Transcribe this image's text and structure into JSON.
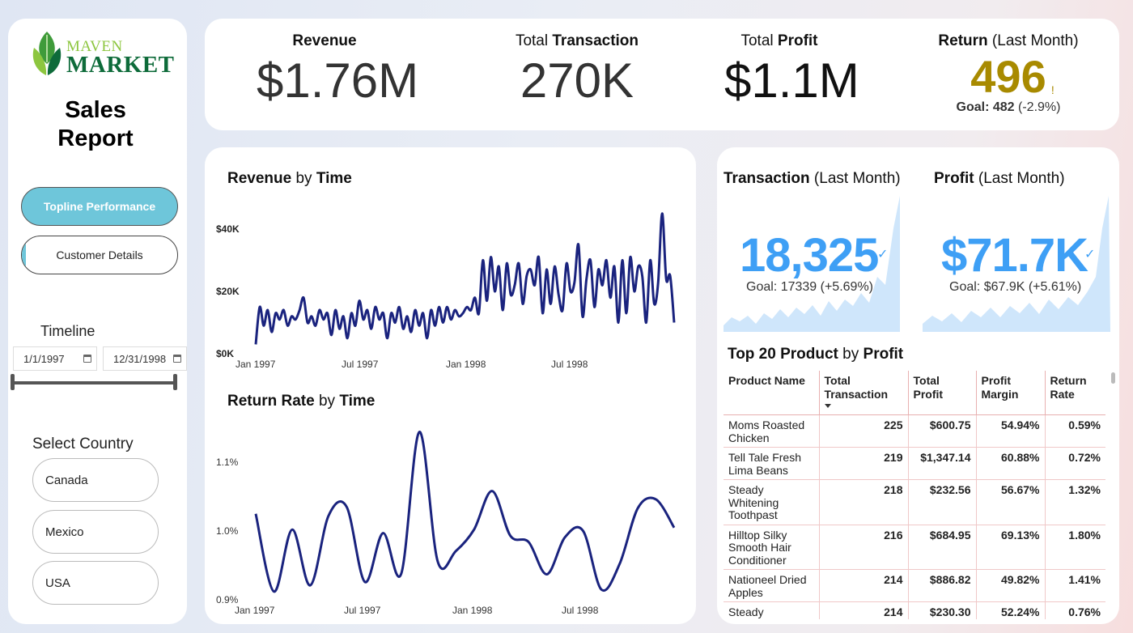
{
  "sidebar": {
    "logo_top": "MAVEN",
    "logo_bottom": "MARKET",
    "title_line1": "Sales",
    "title_line2": "Report",
    "nav": {
      "topline": "Topline Performance",
      "customer": "Customer Details"
    },
    "timeline_label": "Timeline",
    "date_start": "1/1/1997",
    "date_end": "12/31/1998",
    "country_label": "Select Country",
    "countries": [
      "Canada",
      "Mexico",
      "USA"
    ]
  },
  "kpi": {
    "revenue": {
      "title_bold": "Revenue",
      "value": "$1.76M"
    },
    "transaction": {
      "title_plain": "Total ",
      "title_bold": "Transaction",
      "value": "270K"
    },
    "profit": {
      "title_plain": "Total ",
      "title_bold": "Profit",
      "value": "$1.1M"
    },
    "return": {
      "title_bold": "Return",
      "title_plain": " (Last Month)",
      "value": "496",
      "warn": "!",
      "goal_label": "Goal: ",
      "goal_value": "482",
      "goal_delta": " (-2.9%)"
    }
  },
  "charts": {
    "revenue_title_bold1": "Revenue",
    "revenue_title_plain": " by ",
    "revenue_title_bold2": "Time",
    "return_title_bold1": "Return Rate",
    "return_title_plain": " by ",
    "return_title_bold2": "Time"
  },
  "chart_data": [
    {
      "type": "line",
      "title": "Revenue by Time",
      "x_ticks": [
        "Jan 1997",
        "Jul 1997",
        "Jan 1998",
        "Jul 1998"
      ],
      "y_ticks": [
        "$0K",
        "$20K",
        "$40K"
      ],
      "ylim": [
        0,
        46000
      ],
      "series": [
        {
          "values": [
            3,
            15,
            9,
            14,
            7,
            13,
            11,
            14,
            9,
            12,
            11,
            14,
            18,
            10,
            12,
            9,
            14,
            11,
            13,
            6,
            14,
            8,
            12,
            5,
            13,
            9,
            17,
            11,
            14,
            8,
            15,
            11,
            13,
            5,
            13,
            10,
            15,
            8,
            12,
            7,
            14,
            9,
            13,
            5,
            14,
            9,
            15,
            10,
            15,
            11,
            14,
            12,
            13,
            15,
            14,
            18,
            13,
            30,
            17,
            31,
            20,
            28,
            14,
            29,
            19,
            22,
            29,
            16,
            25,
            27,
            22,
            31,
            13,
            27,
            16,
            28,
            19,
            14,
            29,
            20,
            23,
            35,
            12,
            24,
            30,
            15,
            27,
            22,
            30,
            18,
            28,
            10,
            30,
            13,
            31,
            20,
            28,
            25,
            10,
            30,
            16,
            23,
            45,
            24,
            25,
            10
          ]
        }
      ]
    },
    {
      "type": "line",
      "title": "Return Rate by Time",
      "x_ticks": [
        "Jan 1997",
        "Jul 1997",
        "Jan 1998",
        "Jul 1998"
      ],
      "y_ticks": [
        "0.9%",
        "1.0%",
        "1.1%"
      ],
      "ylim": [
        0.9,
        1.12
      ],
      "series": [
        {
          "values": [
            1.025,
            0.912,
            1.002,
            0.921,
            1.022,
            1.035,
            0.926,
            0.997,
            0.938,
            1.144,
            0.956,
            0.971,
            1.002,
            1.058,
            0.993,
            0.984,
            0.937,
            0.991,
            1.0,
            0.915,
            0.952,
            1.033,
            1.046,
            1.005
          ]
        }
      ]
    }
  ],
  "right": {
    "trans_title_bold": "Transaction",
    "trans_title_plain": " (Last Month)",
    "trans_value": "18,325",
    "trans_goal": "Goal: 17339 (+5.69%)",
    "profit_title_bold": "Profit",
    "profit_title_plain": " (Last Month)",
    "profit_value": "$71.7K",
    "profit_goal": "Goal: $67.9K (+5.61%)",
    "check": "✓",
    "table_title_bold1": "Top 20 Product",
    "table_title_plain": " by ",
    "table_title_bold2": "Profit",
    "table_headers": [
      "Product Name",
      "Total Transaction",
      "Total Profit",
      "Profit Margin",
      "Return Rate"
    ],
    "table_rows": [
      [
        "Moms Roasted Chicken",
        "225",
        "$600.75",
        "54.94%",
        "0.59%"
      ],
      [
        "Tell Tale Fresh Lima Beans",
        "219",
        "$1,347.14",
        "60.88%",
        "0.72%"
      ],
      [
        "Steady Whitening Toothpast",
        "218",
        "$232.56",
        "56.67%",
        "1.32%"
      ],
      [
        "Hilltop Silky Smooth Hair Conditioner",
        "216",
        "$684.95",
        "69.13%",
        "1.80%"
      ],
      [
        "Nationeel Dried Apples",
        "214",
        "$886.82",
        "49.82%",
        "1.41%"
      ],
      [
        "Steady Childrens Cold",
        "214",
        "$230.30",
        "52.24%",
        "0.76%"
      ]
    ]
  },
  "colors": {
    "accent": "#6ec6da",
    "kpi_blue": "#3e9ff5",
    "warn": "#a88a00",
    "line": "#1a237e",
    "spark_fill": "#cfe6fb"
  }
}
